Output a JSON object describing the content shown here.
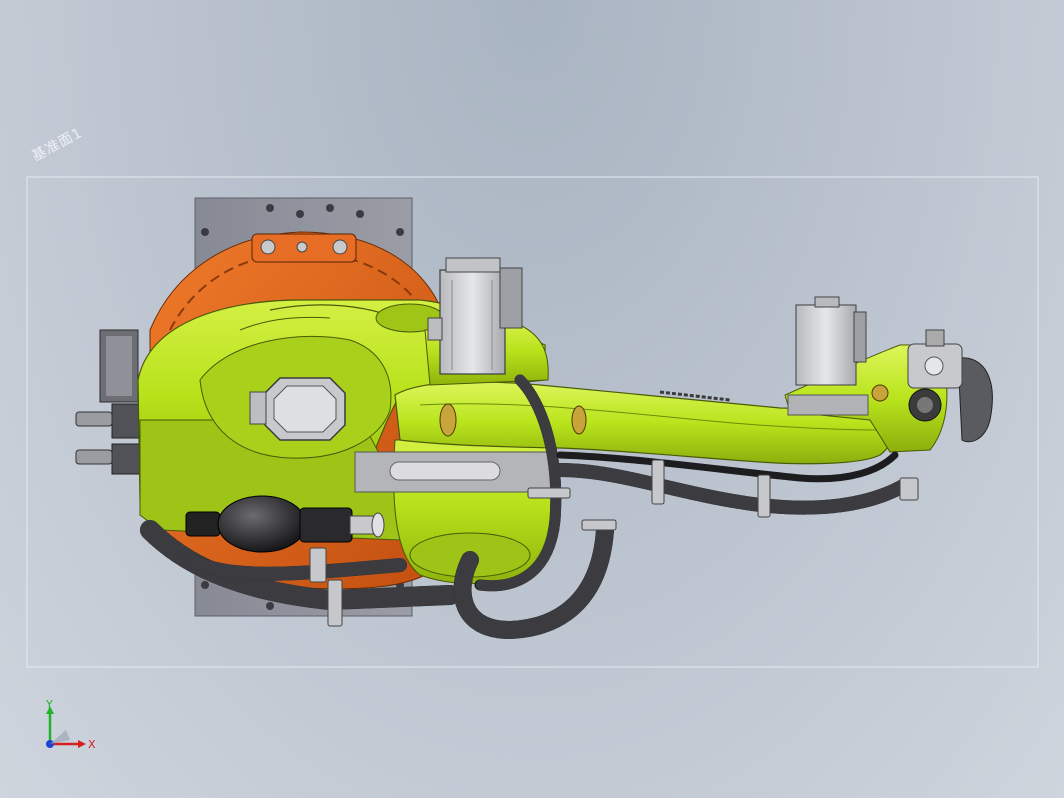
{
  "viewport": {
    "plane_label": "基准面1",
    "triad": {
      "x_label": "X",
      "y_label": "Y"
    }
  },
  "colors": {
    "body_green": "#b7e21a",
    "flange_orange": "#e2651a",
    "plate_gray": "#8e9099",
    "motor_gray": "#cfd0d4",
    "hose_black": "#1d1d1f",
    "plane_outline": "#e6eaf0"
  }
}
